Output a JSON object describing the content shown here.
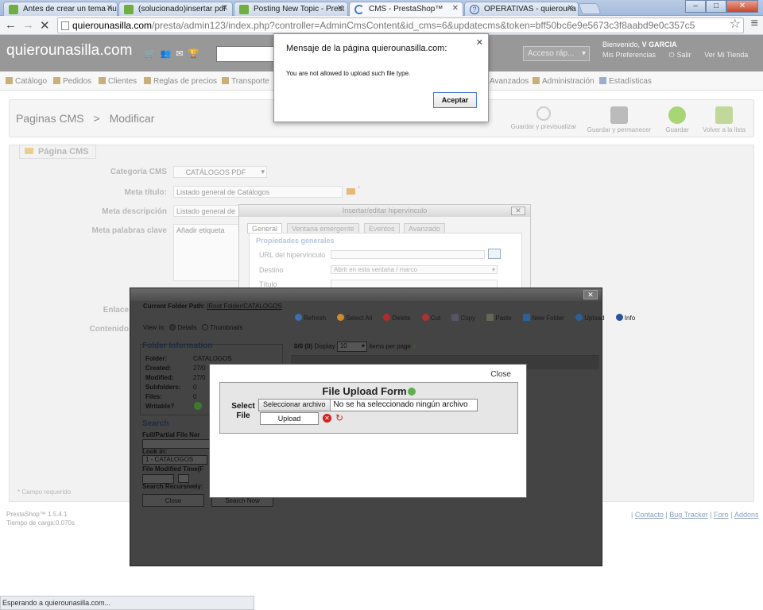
{
  "browser": {
    "tabs": [
      {
        "title": "Antes de crear un tema nu"
      },
      {
        "title": "(solucionado)insertar pdf"
      },
      {
        "title": "Posting New Topic - Prest"
      },
      {
        "title": "CMS - PrestaShop™"
      },
      {
        "title": "OPERATIVAS - quierouna"
      }
    ],
    "url_domain": "quierounasilla.com",
    "url_rest": "/presta/admin123/index.php?controller=AdminCmsContent&id_cms=6&updatecms&token=bff50bc6e9e5673c3f8aabd9e0c357c5",
    "status_text": "Esperando a quierounasilla.com..."
  },
  "header": {
    "logo": "quierounasilla.com",
    "quick_access": "Acceso ráp...",
    "welcome_prefix": "Bienvenido,",
    "welcome_user": "V GARCIA",
    "prefs": "Mis Preferencias",
    "logout": "Salir",
    "view_shop": "Ver Mi Tienda"
  },
  "menu": {
    "items": [
      "Catálogo",
      "Pedidos",
      "Clientes",
      "Reglas de precios",
      "Transporte",
      "Avanzados",
      "Administración",
      "Estadísticas"
    ]
  },
  "page": {
    "breadcrumb_1": "Paginas CMS",
    "breadcrumb_sep": ">",
    "breadcrumb_2": "Modificar",
    "toolbar": [
      "Guardar y previsualizar",
      "Guardar y permanecer",
      "Guardar",
      "Volver a la lista"
    ]
  },
  "form": {
    "legend": "Página CMS",
    "labels": [
      "Categoría CMS",
      "Meta título:",
      "Meta descripción",
      "Meta palabras clave",
      "Enlace",
      "Contenido"
    ],
    "category_value": "CATÁLOGOS PDF",
    "meta_title_value": "Listado general de Catálogos",
    "meta_desc_value": "Listado general de",
    "tags_placeholder": "Añadir etiqueta",
    "required_note": "* Campo requerido"
  },
  "footer": {
    "version": "PrestaShop™ 1.5.4.1",
    "load_time": "Tiempo de carga:0.070s",
    "links": [
      "Contacto",
      "Bug Tracker",
      "Foro",
      "Addons"
    ]
  },
  "hyperlink_dialog": {
    "title": "Insertar/editar hipervínculo",
    "tabs": [
      "General",
      "Ventana emergente",
      "Eventos",
      "Avanzado"
    ],
    "legend": "Propiedades generales",
    "url_label": "URL del hipervínculo",
    "target_label": "Destino",
    "target_value": "Abrir en esta ventana / marco",
    "title_label": "Título"
  },
  "file_manager": {
    "path_label": "Current Folder Path:",
    "path_root": "/Root Folder/",
    "path_folder": "CATALOGOS",
    "toolbar": [
      "Refresh",
      "Select All",
      "Delete",
      "Cut",
      "Copy",
      "Paste",
      "New Folder",
      "Upload",
      "Info"
    ],
    "view_in": "View in:",
    "view_details": "Details",
    "view_thumbs": "Thumbnails",
    "count": "0/0 (0)",
    "display_label": "Display",
    "display_value": "10",
    "items_per_page": "items per page",
    "folder_info_title": "Folder Information",
    "info_labels": [
      "Folder:",
      "Created:",
      "Modified:",
      "Subfolders:",
      "Files:",
      "Writable?"
    ],
    "info_values": [
      "CATALOGOS",
      "27/0",
      "27/0",
      "0",
      "0"
    ],
    "search_title": "Search",
    "search_fields": [
      "Full/Partial File Nar",
      "Look in:",
      "File Modified Time(F",
      "Search Recursively:"
    ],
    "look_in_value": "1 - CATALOGOS",
    "close_btn": "Close",
    "search_btn": "Search Now"
  },
  "upload_dialog": {
    "close": "Close",
    "title": "File Upload Form",
    "select_label": "Select File",
    "choose_btn": "Seleccionar archivo",
    "no_file": "No se ha seleccionado ningún archivo",
    "upload_btn": "Upload"
  },
  "alert": {
    "title": "Mensaje de la página quierounasilla.com:",
    "message": "You are not allowed to upload such file type.",
    "ok": "Aceptar"
  }
}
